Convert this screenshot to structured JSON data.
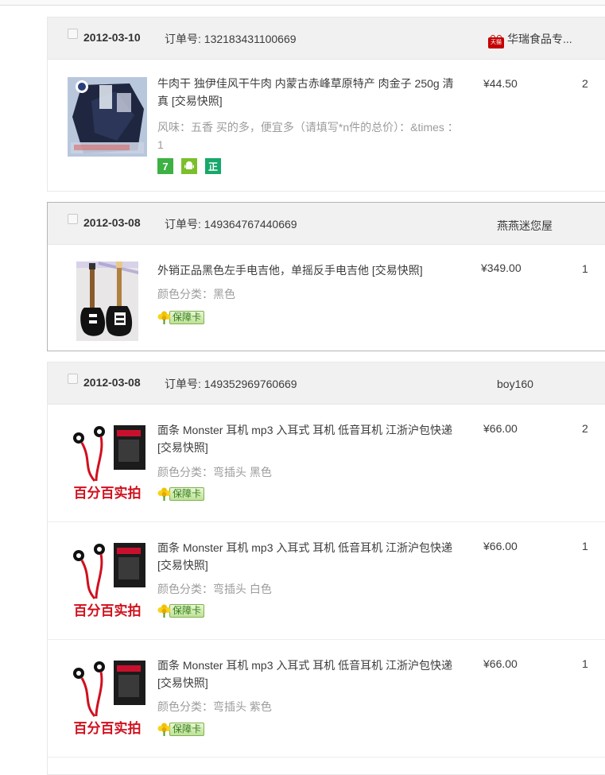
{
  "colors": {
    "header_bg": "#f1f1f1",
    "tmall_red": "#c40000",
    "attr_gray": "#9c9c9c",
    "service_green": "#3db143"
  },
  "order_no_label": "订单号: ",
  "orders": [
    {
      "date": "2012-03-10",
      "order_no": "132183431100669",
      "seller": "华瑞食品专...",
      "seller_badge": "天猫",
      "items": [
        {
          "title": "牛肉干 独伊佳风干牛肉 内蒙古赤峰草原特产 肉金子 250g 清真 [交易快照]",
          "attr": "风味：五香  买的多，便宜多（请填写*n件的总价）：&times  ：1",
          "price": "¥44.50",
          "qty": "2",
          "services": [
            "7",
            "android",
            "正"
          ]
        }
      ]
    },
    {
      "date": "2012-03-08",
      "order_no": "149364767440669",
      "seller": "燕燕迷您屋",
      "items": [
        {
          "title": "外销正品黑色左手电吉他，单摇反手电吉他 [交易快照]",
          "attr": "颜色分类：黑色",
          "price": "¥349.00",
          "qty": "1",
          "service_label": "保障卡"
        }
      ]
    },
    {
      "date": "2012-03-08",
      "order_no": "149352969760669",
      "seller": "boy160",
      "items": [
        {
          "title": "面条 Monster 耳机 mp3 入耳式 耳机 低音耳机 江浙沪包快递 [交易快照]",
          "attr": "颜色分类：弯插头 黑色",
          "price": "¥66.00",
          "qty": "2",
          "service_label": "保障卡",
          "image_caption": "百分百实拍"
        },
        {
          "title": "面条 Monster 耳机 mp3 入耳式 耳机 低音耳机 江浙沪包快递 [交易快照]",
          "attr": "颜色分类：弯插头 白色",
          "price": "¥66.00",
          "qty": "1",
          "service_label": "保障卡",
          "image_caption": "百分百实拍"
        },
        {
          "title": "面条 Monster 耳机 mp3 入耳式 耳机 低音耳机 江浙沪包快递 [交易快照]",
          "attr": "颜色分类：弯插头 紫色",
          "price": "¥66.00",
          "qty": "1",
          "service_label": "保障卡",
          "image_caption": "百分百实拍"
        }
      ]
    }
  ]
}
